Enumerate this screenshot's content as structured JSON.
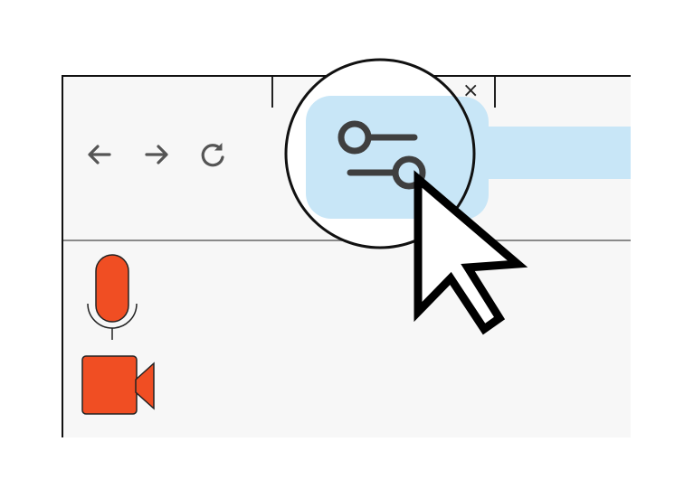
{
  "window": {
    "tab_close_label": "×"
  },
  "toolbar": {
    "back_icon": "arrow-left",
    "forward_icon": "arrow-right",
    "reload_icon": "reload",
    "site_settings_icon": "tune-sliders"
  },
  "permissions": {
    "microphone_icon": "microphone",
    "camera_icon": "video-camera"
  },
  "colors": {
    "address_bar": "#c8e6f7",
    "icon_gray": "#555555",
    "permission_orange": "#f04e23",
    "window_bg": "#f7f7f7"
  },
  "cursor": "arrow-pointer"
}
